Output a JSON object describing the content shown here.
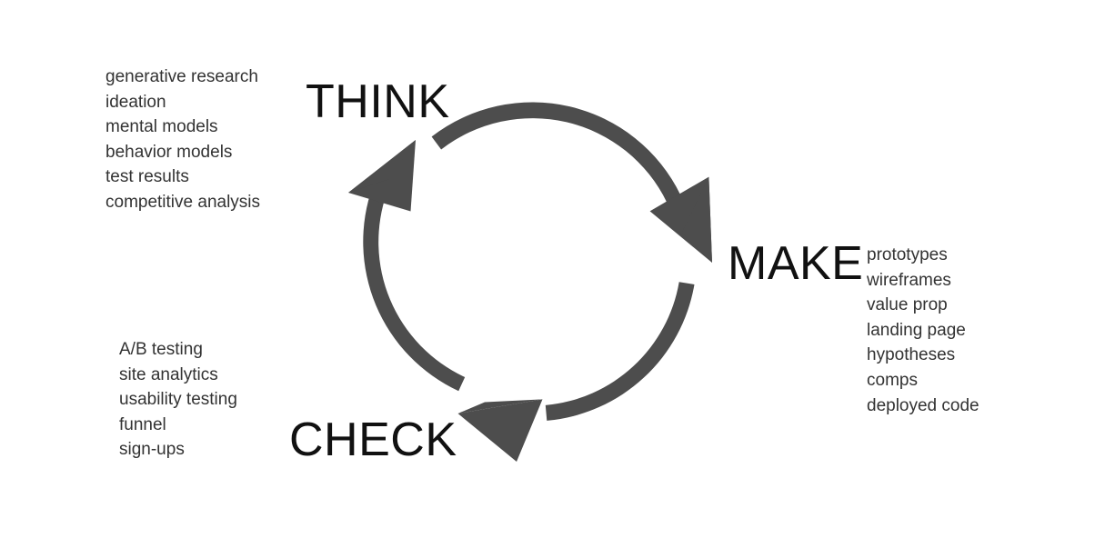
{
  "diagram": {
    "title": "Think / Make / Check iterative design cycle",
    "type": "cycle-diagram",
    "direction": "clockwise",
    "colors": {
      "arrow": "#4d4d4d",
      "stage_label": "#111111",
      "keyword_text": "#333333",
      "background": "#ffffff"
    },
    "stages": [
      {
        "id": "think",
        "label": "THINK",
        "keywords": [
          "generative research",
          "ideation",
          "mental models",
          "behavior models",
          "test results",
          "competitive analysis"
        ]
      },
      {
        "id": "make",
        "label": "MAKE",
        "keywords": [
          "prototypes",
          "wireframes",
          "value prop",
          "landing page",
          "hypotheses",
          "comps",
          "deployed code"
        ]
      },
      {
        "id": "check",
        "label": "CHECK",
        "keywords": [
          "A/B testing",
          "site analytics",
          "usability testing",
          "funnel",
          "sign-ups"
        ]
      }
    ],
    "arrows": [
      {
        "id": "think-to-make",
        "from": "think",
        "to": "make",
        "icon": "curved-arrow-icon"
      },
      {
        "id": "make-to-check",
        "from": "make",
        "to": "check",
        "icon": "curved-arrow-icon"
      },
      {
        "id": "check-to-think",
        "from": "check",
        "to": "think",
        "icon": "curved-arrow-icon"
      }
    ]
  }
}
